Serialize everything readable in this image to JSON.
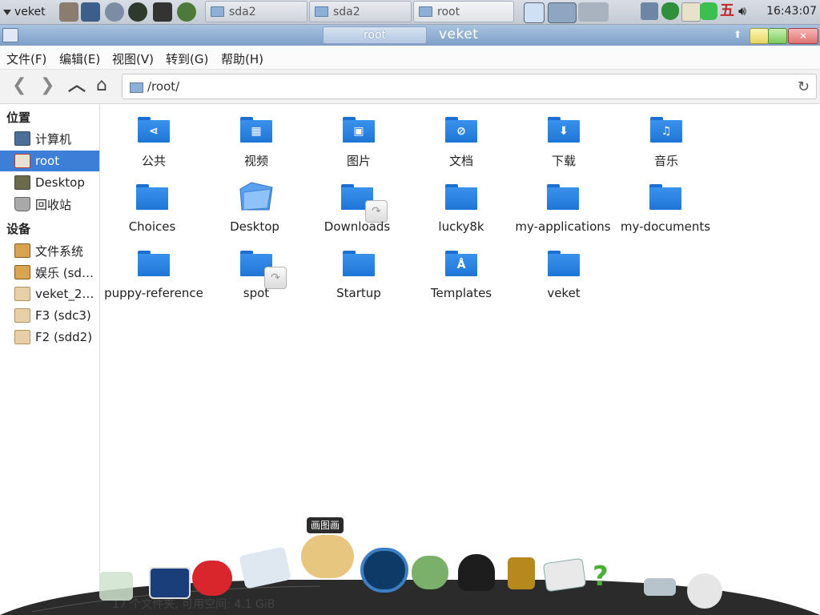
{
  "taskbar": {
    "start_label": "veket",
    "tasks": [
      {
        "label": "sda2",
        "active": false
      },
      {
        "label": "sda2",
        "active": false
      },
      {
        "label": "root",
        "active": true
      }
    ],
    "ime_label": "五",
    "clock": "16:43:07"
  },
  "window": {
    "tab_label": "root",
    "title": "veket"
  },
  "menu": [
    "文件(F)",
    "编辑(E)",
    "视图(V)",
    "转到(G)",
    "帮助(H)"
  ],
  "location": {
    "path": "/root/"
  },
  "sidebar": {
    "places_header": "位置",
    "places": [
      {
        "label": "计算机",
        "icon": "computer-icon",
        "selected": false
      },
      {
        "label": "root",
        "icon": "home-icon",
        "selected": true
      },
      {
        "label": "Desktop",
        "icon": "desktop-icon",
        "selected": false
      },
      {
        "label": "回收站",
        "icon": "trash-icon",
        "selected": false
      }
    ],
    "devices_header": "设备",
    "devices": [
      {
        "label": "文件系统",
        "icon": "drive-icon"
      },
      {
        "label": "娱乐 (sd…",
        "icon": "drive-icon"
      },
      {
        "label": "veket_2…",
        "icon": "drive-icon"
      },
      {
        "label": "F3 (sdc3)",
        "icon": "drive-icon"
      },
      {
        "label": "F2 (sdd2)",
        "icon": "drive-icon"
      }
    ]
  },
  "files": [
    {
      "label": "公共",
      "icon": "share-folder-icon",
      "glyph": "⋖",
      "link": false
    },
    {
      "label": "视频",
      "icon": "video-folder-icon",
      "glyph": "▦",
      "link": false
    },
    {
      "label": "图片",
      "icon": "picture-folder-icon",
      "glyph": "▣",
      "link": false
    },
    {
      "label": "文档",
      "icon": "document-folder-icon",
      "glyph": "⊘",
      "link": false
    },
    {
      "label": "下载",
      "icon": "download-folder-icon",
      "glyph": "⬇",
      "link": false
    },
    {
      "label": "音乐",
      "icon": "music-folder-icon",
      "glyph": "♫",
      "link": false
    },
    {
      "label": "Choices",
      "icon": "folder-icon",
      "glyph": "",
      "link": false
    },
    {
      "label": "Desktop",
      "icon": "desktop-folder-icon",
      "glyph": "",
      "link": false
    },
    {
      "label": "Downloads",
      "icon": "folder-icon",
      "glyph": "",
      "link": true
    },
    {
      "label": "lucky8k",
      "icon": "folder-icon",
      "glyph": "",
      "link": false
    },
    {
      "label": "my-applications",
      "icon": "folder-icon",
      "glyph": "",
      "link": false
    },
    {
      "label": "my-documents",
      "icon": "folder-icon",
      "glyph": "",
      "link": false
    },
    {
      "label": "puppy-reference",
      "icon": "folder-icon",
      "glyph": "",
      "link": false
    },
    {
      "label": "spot",
      "icon": "folder-icon",
      "glyph": "",
      "link": true
    },
    {
      "label": "Startup",
      "icon": "folder-icon",
      "glyph": "",
      "link": false
    },
    {
      "label": "Templates",
      "icon": "template-folder-icon",
      "glyph": "Å",
      "link": false
    },
    {
      "label": "veket",
      "icon": "folder-icon",
      "glyph": "",
      "link": false
    }
  ],
  "status": "17 个文件夹, 可用空间: 4.1 GiB",
  "dock": {
    "tooltip": "画图画"
  }
}
